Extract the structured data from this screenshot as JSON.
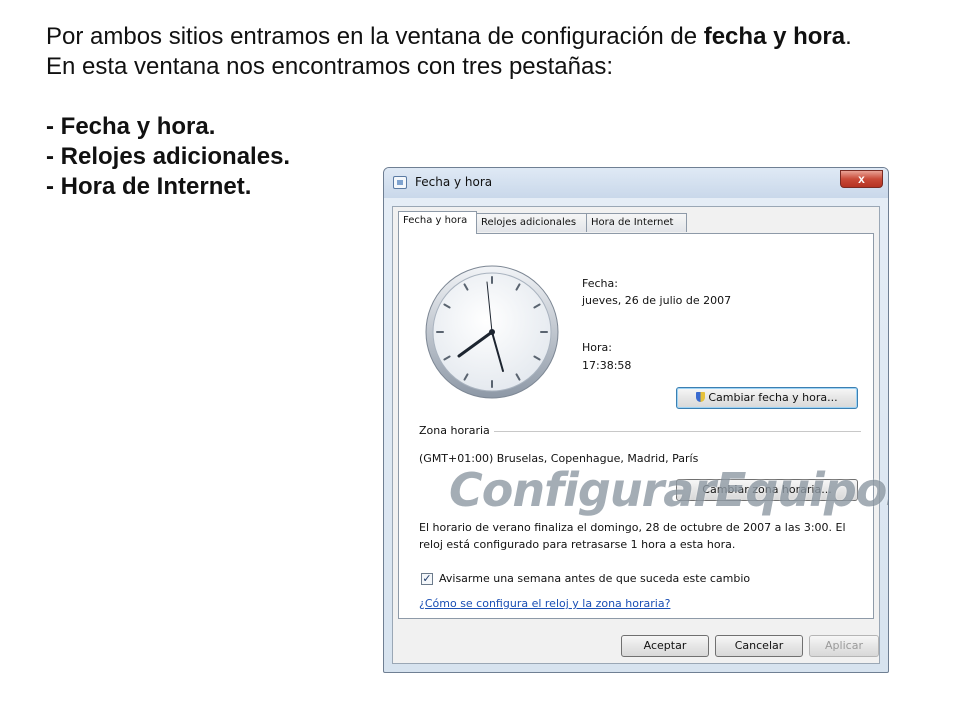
{
  "slide": {
    "intro_part1": "Por ambos sitios entramos en la ventana de configuración de ",
    "intro_bold": "fecha y hora",
    "intro_part2": ". En esta ventana nos encontramos con tres pestañas:",
    "list": [
      "- Fecha y hora.",
      "- Relojes adicionales.",
      "- Hora de Internet."
    ]
  },
  "window": {
    "title": "Fecha y hora",
    "close_label": "x",
    "tabs": [
      {
        "label": "Fecha y hora",
        "active": true
      },
      {
        "label": "Relojes adicionales",
        "active": false
      },
      {
        "label": "Hora de Internet",
        "active": false
      }
    ],
    "date_label": "Fecha:",
    "date_value": "jueves, 26 de julio de 2007",
    "time_label": "Hora:",
    "time_value": "17:38:58",
    "change_datetime_button": "Cambiar fecha y hora...",
    "timezone_label": "Zona horaria",
    "timezone_value": "(GMT+01:00) Bruselas, Copenhague, Madrid, París",
    "change_timezone_button": "Cambiar zona horaria...",
    "dst_line1": "El horario de verano finaliza el domingo, 28 de octubre de 2007 a las 3:00. El",
    "dst_line2": "reloj está configurado para retrasarse 1 hora a esta hora.",
    "notify_checkbox_label": "Avisarme una semana antes de que suceda este cambio",
    "notify_checked": true,
    "help_link": "¿Cómo se configura el reloj y la zona horaria?",
    "ok_button": "Aceptar",
    "cancel_button": "Cancelar",
    "apply_button": "Aplicar",
    "watermark": "ConfigurarEquipos"
  }
}
